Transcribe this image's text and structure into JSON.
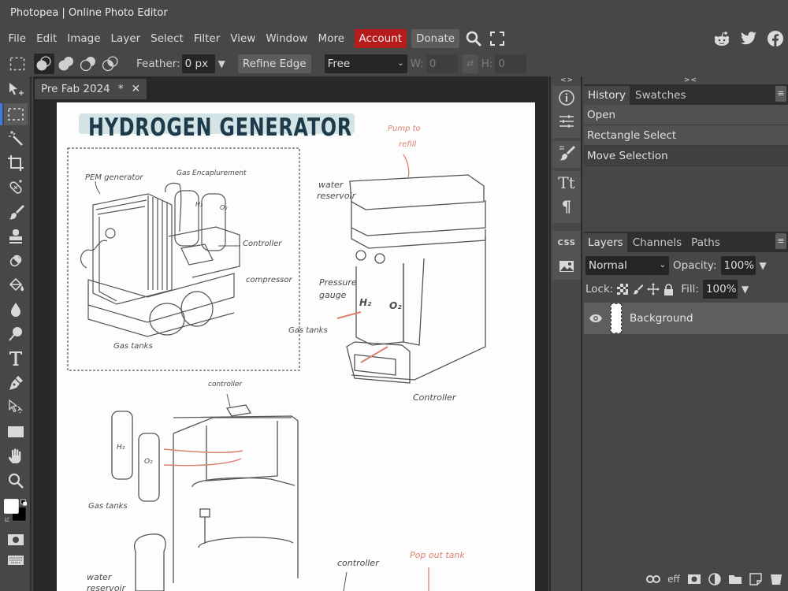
{
  "window": {
    "title": "Photopea | Online Photo Editor"
  },
  "menubar": {
    "items": [
      "File",
      "Edit",
      "Image",
      "Layer",
      "Select",
      "Filter",
      "View",
      "Window",
      "More"
    ],
    "account_label": "Account",
    "donate_label": "Donate",
    "account_color": "#b71c1c",
    "icons": [
      "search-icon",
      "fullscreen-icon"
    ],
    "social_icons": [
      "reddit-icon",
      "twitter-icon",
      "facebook-icon"
    ]
  },
  "options": {
    "feather_label": "Feather:",
    "feather_value": "0 px",
    "refine_edge_label": "Refine Edge",
    "style_value": "Free",
    "w_label": "W:",
    "w_value": "0",
    "h_label": "H:",
    "h_value": "0"
  },
  "tools": [
    "move",
    "rectangle-select",
    "magic-wand",
    "crop",
    "healing-brush",
    "brush",
    "clone-stamp",
    "eraser",
    "paint-bucket",
    "blur",
    "dodge",
    "type",
    "pen",
    "path-select",
    "rectangle-shape",
    "hand",
    "zoom",
    "color-swatches",
    "quick-mask",
    "keyboard"
  ],
  "document": {
    "tab_name": "Pre Fab 2024",
    "modified_marker": "*",
    "close_glyph": "✕"
  },
  "canvas": {
    "title": "HYDROGEN GENERATOR",
    "title_highlight_color": "#d4e4e6",
    "title_color": "#1d3a4a",
    "annotations": {
      "pem_generator": "PEM generator",
      "gas_encapsulement": "Gas Encaplurement",
      "controller_1": "Controller",
      "compressor": "compressor",
      "gas_tanks_1": "Gas tanks",
      "h2_small": "H₂",
      "o2_small": "O₂",
      "pump_to_refill": [
        "Pump to",
        "refill"
      ],
      "water_reservoir_1": [
        "water",
        "reservoir"
      ],
      "pressure_gauge": [
        "Pressure",
        "gauge"
      ],
      "gas_tanks_2": "Gas tanks",
      "h2_large": "H₂",
      "o2_large": "O₂",
      "controller_2": "Controller",
      "controller_3": "controller",
      "h2_bottle": "H₂",
      "o2_bottle": "O₂",
      "gas_tanks_3": "Gas tanks",
      "water_reservoir_2": [
        "water",
        "reservoir"
      ],
      "controller_4": "controller",
      "pop_out_tank": "Pop out tank"
    }
  },
  "history_panel": {
    "tabs": [
      "History",
      "Swatches"
    ],
    "items": [
      "Open",
      "Rectangle Select",
      "Move Selection"
    ],
    "current_index": 2
  },
  "layers_panel": {
    "tabs": [
      "Layers",
      "Channels",
      "Paths"
    ],
    "blend_mode": "Normal",
    "opacity_label": "Opacity:",
    "opacity_value": "100%",
    "lock_label": "Lock:",
    "fill_label": "Fill:",
    "fill_value": "100%",
    "layers": [
      {
        "name": "Background",
        "visible": true
      }
    ],
    "bottom_icons": [
      "link-icon",
      "effects-icon",
      "mask-icon",
      "adjustment-icon",
      "folder-icon",
      "new-layer-icon",
      "trash-icon"
    ],
    "effects_label": "eff"
  },
  "right_column": {
    "collapse_left": "<>",
    "collapse_right": "><",
    "icons": [
      "info-icon",
      "adjustments-icon",
      "brush-settings-icon",
      "character-icon",
      "paragraph-icon",
      "css-icon",
      "image-icon"
    ],
    "css_label": "CSS",
    "tt_label": "Tt",
    "para_label": "¶"
  }
}
